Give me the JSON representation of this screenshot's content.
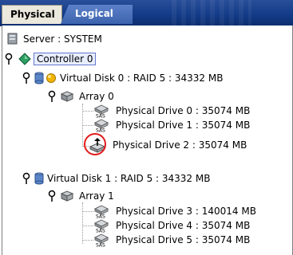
{
  "tabs": [
    {
      "label": "Physical",
      "active": true
    },
    {
      "label": "Logical",
      "active": false
    }
  ],
  "tree": {
    "server": "Server : SYSTEM",
    "controller": "Controller 0",
    "vd0": "Virtual Disk 0 : RAID 5 : 34332 MB",
    "array0": "Array 0",
    "pd0": "Physical Drive 0 : 35074 MB",
    "pd1": "Physical Drive 1 : 35074 MB",
    "pd2": "Physical Drive 2 : 35074 MB",
    "vd1": "Virtual Disk 1 : RAID 5 : 34332 MB",
    "array1": "Array 1",
    "pd3": "Physical Drive 3 : 140014 MB",
    "pd4": "Physical Drive 4 : 35074 MB",
    "pd5": "Physical Drive 5 : 35074 MB"
  },
  "icons": {
    "drive_badge": "SAS"
  },
  "colors": {
    "tab_bar": "#123a86",
    "selection_outline": "#6677cc",
    "highlight_circle": "#e21b1b",
    "warning_dot": "#f1b400"
  }
}
